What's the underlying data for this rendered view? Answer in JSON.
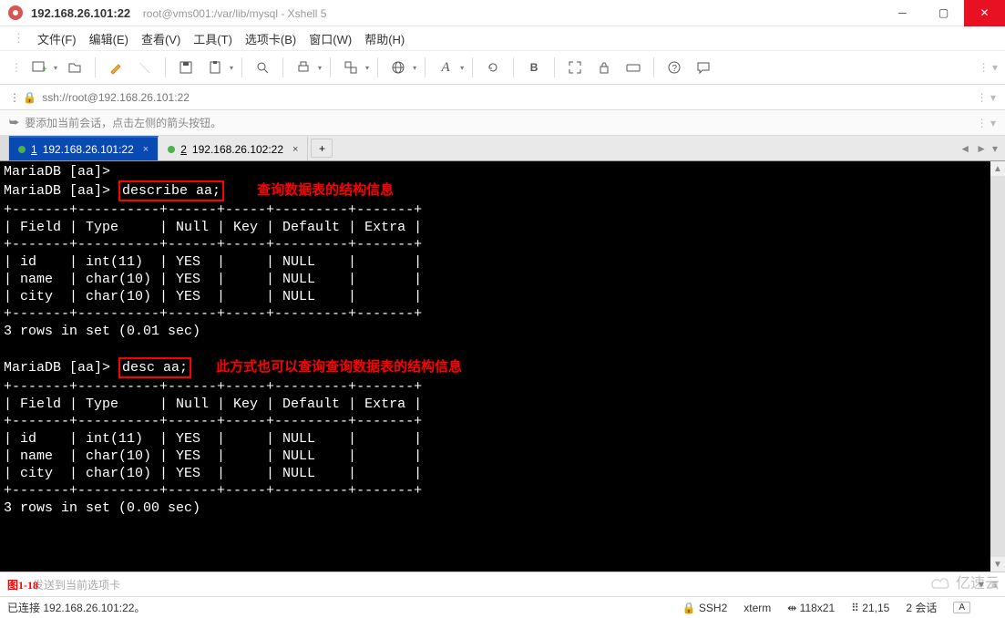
{
  "window": {
    "host_port": "192.168.26.101:22",
    "title_path": "root@vms001:/var/lib/mysql - Xshell 5"
  },
  "menu": {
    "file": "文件(F)",
    "edit": "编辑(E)",
    "view": "查看(V)",
    "tools": "工具(T)",
    "tabs": "选项卡(B)",
    "windows": "窗口(W)",
    "help": "帮助(H)"
  },
  "toolbar_icons": [
    "new",
    "open",
    "pen",
    "backslash",
    "save",
    "clipboard",
    "search",
    "printer",
    "layers",
    "globe",
    "font",
    "refresh",
    "bold",
    "expand",
    "lock",
    "keyboard",
    "help",
    "chat"
  ],
  "address": {
    "url": "ssh://root@192.168.26.101:22"
  },
  "hint": {
    "text": "要添加当前会话，点击左侧的箭头按钮。"
  },
  "tabs": {
    "items": [
      {
        "num": "1",
        "label": "192.168.26.101:22",
        "active": true
      },
      {
        "num": "2",
        "label": "192.168.26.102:22",
        "active": false
      }
    ],
    "add": "+"
  },
  "terminal": {
    "prompt": "MariaDB [aa]>",
    "cmd1": "describe aa;",
    "anno1": "查询数据表的结构信息",
    "header_sep": "+-------+----------+------+-----+---------+-------+",
    "header": "| Field | Type     | Null | Key | Default | Extra |",
    "rows": [
      "| id    | int(11)  | YES  |     | NULL    |       |",
      "| name  | char(10) | YES  |     | NULL    |       |",
      "| city  | char(10) | YES  |     | NULL    |       |"
    ],
    "result1": "3 rows in set (0.01 sec)",
    "cmd2": "desc aa;",
    "anno2": "此方式也可以查询查询数据表的结构信息",
    "result2": "3 rows in set (0.00 sec)"
  },
  "input_row": {
    "figure": "图1-18",
    "placeholder": "发送到当前选项卡"
  },
  "status": {
    "conn": "已连接 192.168.26.101:22。",
    "proto": "SSH2",
    "term": "xterm",
    "size": "118x21",
    "pos": "21,15",
    "sessions": "2 会话"
  },
  "watermark": "亿速云"
}
